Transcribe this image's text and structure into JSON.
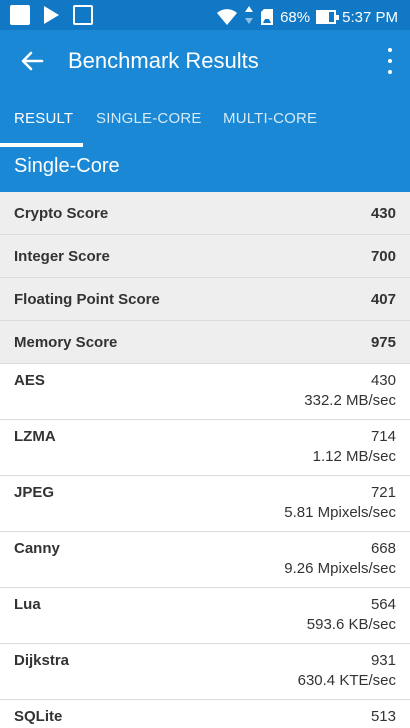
{
  "status_bar": {
    "battery": "68%",
    "time": "5:37 PM"
  },
  "app_bar": {
    "title": "Benchmark Results"
  },
  "tabs": [
    {
      "label": "RESULT",
      "active": true
    },
    {
      "label": "SINGLE-CORE",
      "active": false
    },
    {
      "label": "MULTI-CORE",
      "active": false
    }
  ],
  "section": {
    "title": "Single-Core"
  },
  "summary": [
    {
      "label": "Crypto Score",
      "value": "430"
    },
    {
      "label": "Integer Score",
      "value": "700"
    },
    {
      "label": "Floating Point Score",
      "value": "407"
    },
    {
      "label": "Memory Score",
      "value": "975"
    }
  ],
  "tests": [
    {
      "name": "AES",
      "score": "430",
      "rate": "332.2 MB/sec"
    },
    {
      "name": "LZMA",
      "score": "714",
      "rate": "1.12 MB/sec"
    },
    {
      "name": "JPEG",
      "score": "721",
      "rate": "5.81 Mpixels/sec"
    },
    {
      "name": "Canny",
      "score": "668",
      "rate": "9.26 Mpixels/sec"
    },
    {
      "name": "Lua",
      "score": "564",
      "rate": "593.6 KB/sec"
    },
    {
      "name": "Dijkstra",
      "score": "931",
      "rate": "630.4 KTE/sec"
    },
    {
      "name": "SQLite",
      "score": "513",
      "rate": ""
    }
  ],
  "colors": {
    "status_bar": "#1078c4",
    "app_bar": "#1a88d4",
    "summary_bg": "#eeeeee"
  }
}
